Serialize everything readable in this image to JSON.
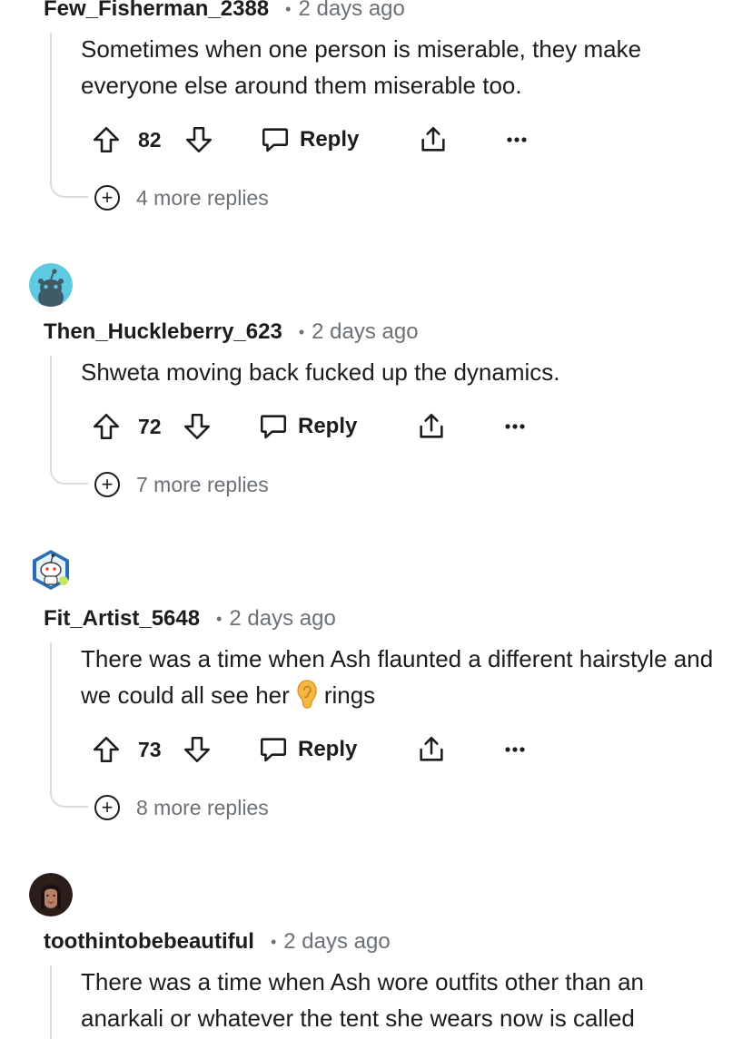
{
  "comments": [
    {
      "username": "Few_Fisherman_2388",
      "separator": "•",
      "time": "2 days ago",
      "body": "Sometimes when one person is miserable, they make everyone else around them miserable too.",
      "votes": "82",
      "reply_label": "Reply",
      "more_replies": "4 more replies"
    },
    {
      "username": "Then_Huckleberry_623",
      "separator": "•",
      "time": "2 days ago",
      "body": "Shweta moving back fucked up the dynamics.",
      "votes": "72",
      "reply_label": "Reply",
      "more_replies": "7 more replies",
      "avatar_color": "#5ec9e0"
    },
    {
      "username": "Fit_Artist_5648",
      "separator": "•",
      "time": "2 days ago",
      "body_before_emoji": "There was a time when Ash flaunted a different hairstyle and we could all see her",
      "emoji": "ear",
      "body_after_emoji": "rings",
      "votes": "73",
      "reply_label": "Reply",
      "more_replies": "8 more replies",
      "avatar_color": "#2a6fb5"
    },
    {
      "username": "toothintobebeautiful",
      "separator": "•",
      "time": "2 days ago",
      "body": "There was a time when Ash wore outfits other than an anarkali or whatever the tent she wears now is called"
    }
  ],
  "icons": {
    "upvote": "arrow-up-icon",
    "downvote": "arrow-down-icon",
    "reply": "speech-bubble-icon",
    "share": "share-icon",
    "more": "ellipsis-icon",
    "expand": "plus-circle-icon"
  },
  "colors": {
    "text": "#1c1c1c",
    "meta": "#6b7176",
    "thread_line": "#d9dcdf"
  }
}
